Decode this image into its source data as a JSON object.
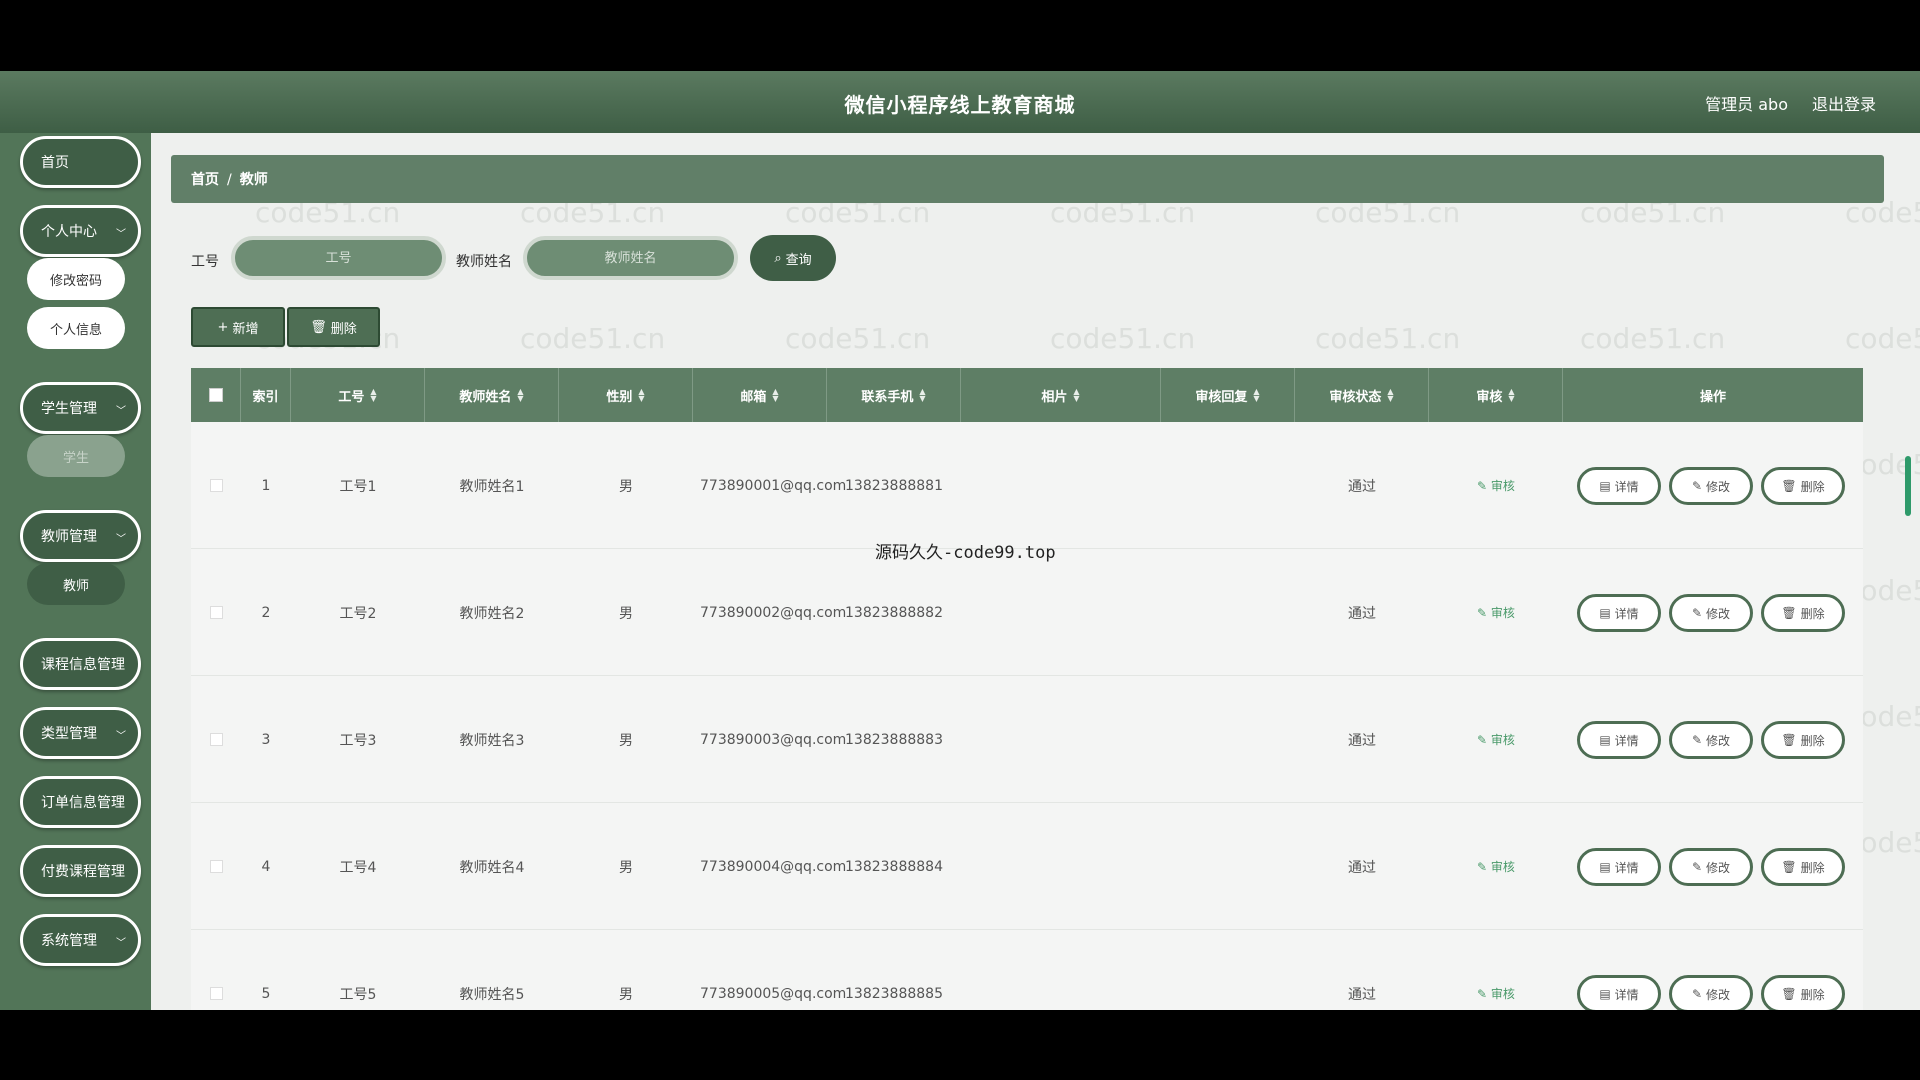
{
  "header": {
    "title": "微信小程序线上教育商城",
    "user": "管理员 abo",
    "logout": "退出登录"
  },
  "sidebar": {
    "home": "首页",
    "personal_center": "个人中心",
    "change_password": "修改密码",
    "personal_info": "个人信息",
    "student_mgmt": "学生管理",
    "student": "学生",
    "teacher_mgmt": "教师管理",
    "teacher": "教师",
    "course_info_mgmt": "课程信息管理",
    "type_mgmt": "类型管理",
    "order_info_mgmt": "订单信息管理",
    "paid_course_mgmt": "付费课程管理",
    "system_mgmt": "系统管理"
  },
  "breadcrumb": {
    "home": "首页",
    "sep": "/",
    "current": "教师"
  },
  "search": {
    "id_label": "工号",
    "id_placeholder": "工号",
    "name_label": "教师姓名",
    "name_placeholder": "教师姓名",
    "query": "查询"
  },
  "actions": {
    "add": "新增",
    "delete": "删除"
  },
  "table": {
    "headers": {
      "index": "索引",
      "id": "工号",
      "name": "教师姓名",
      "gender": "性别",
      "email": "邮箱",
      "phone": "联系手机",
      "photo": "相片",
      "reply": "审核回复",
      "status": "审核状态",
      "audit": "审核",
      "ops": "操作"
    },
    "rows": [
      {
        "index": "1",
        "id": "工号1",
        "name": "教师姓名1",
        "gender": "男",
        "email": "773890001@qq.com",
        "phone": "13823888881",
        "status": "通过",
        "audit": "审核"
      },
      {
        "index": "2",
        "id": "工号2",
        "name": "教师姓名2",
        "gender": "男",
        "email": "773890002@qq.com",
        "phone": "13823888882",
        "status": "通过",
        "audit": "审核"
      },
      {
        "index": "3",
        "id": "工号3",
        "name": "教师姓名3",
        "gender": "男",
        "email": "773890003@qq.com",
        "phone": "13823888883",
        "status": "通过",
        "audit": "审核"
      },
      {
        "index": "4",
        "id": "工号4",
        "name": "教师姓名4",
        "gender": "男",
        "email": "773890004@qq.com",
        "phone": "13823888884",
        "status": "通过",
        "audit": "审核"
      },
      {
        "index": "5",
        "id": "工号5",
        "name": "教师姓名5",
        "gender": "男",
        "email": "773890005@qq.com",
        "phone": "13823888885",
        "status": "通过",
        "audit": "审核"
      }
    ],
    "row_ops": {
      "detail": "详情",
      "edit": "修改",
      "delete": "删除"
    }
  },
  "overlay_text": "源码久久-code99.top",
  "watermark_text": "code51.cn"
}
